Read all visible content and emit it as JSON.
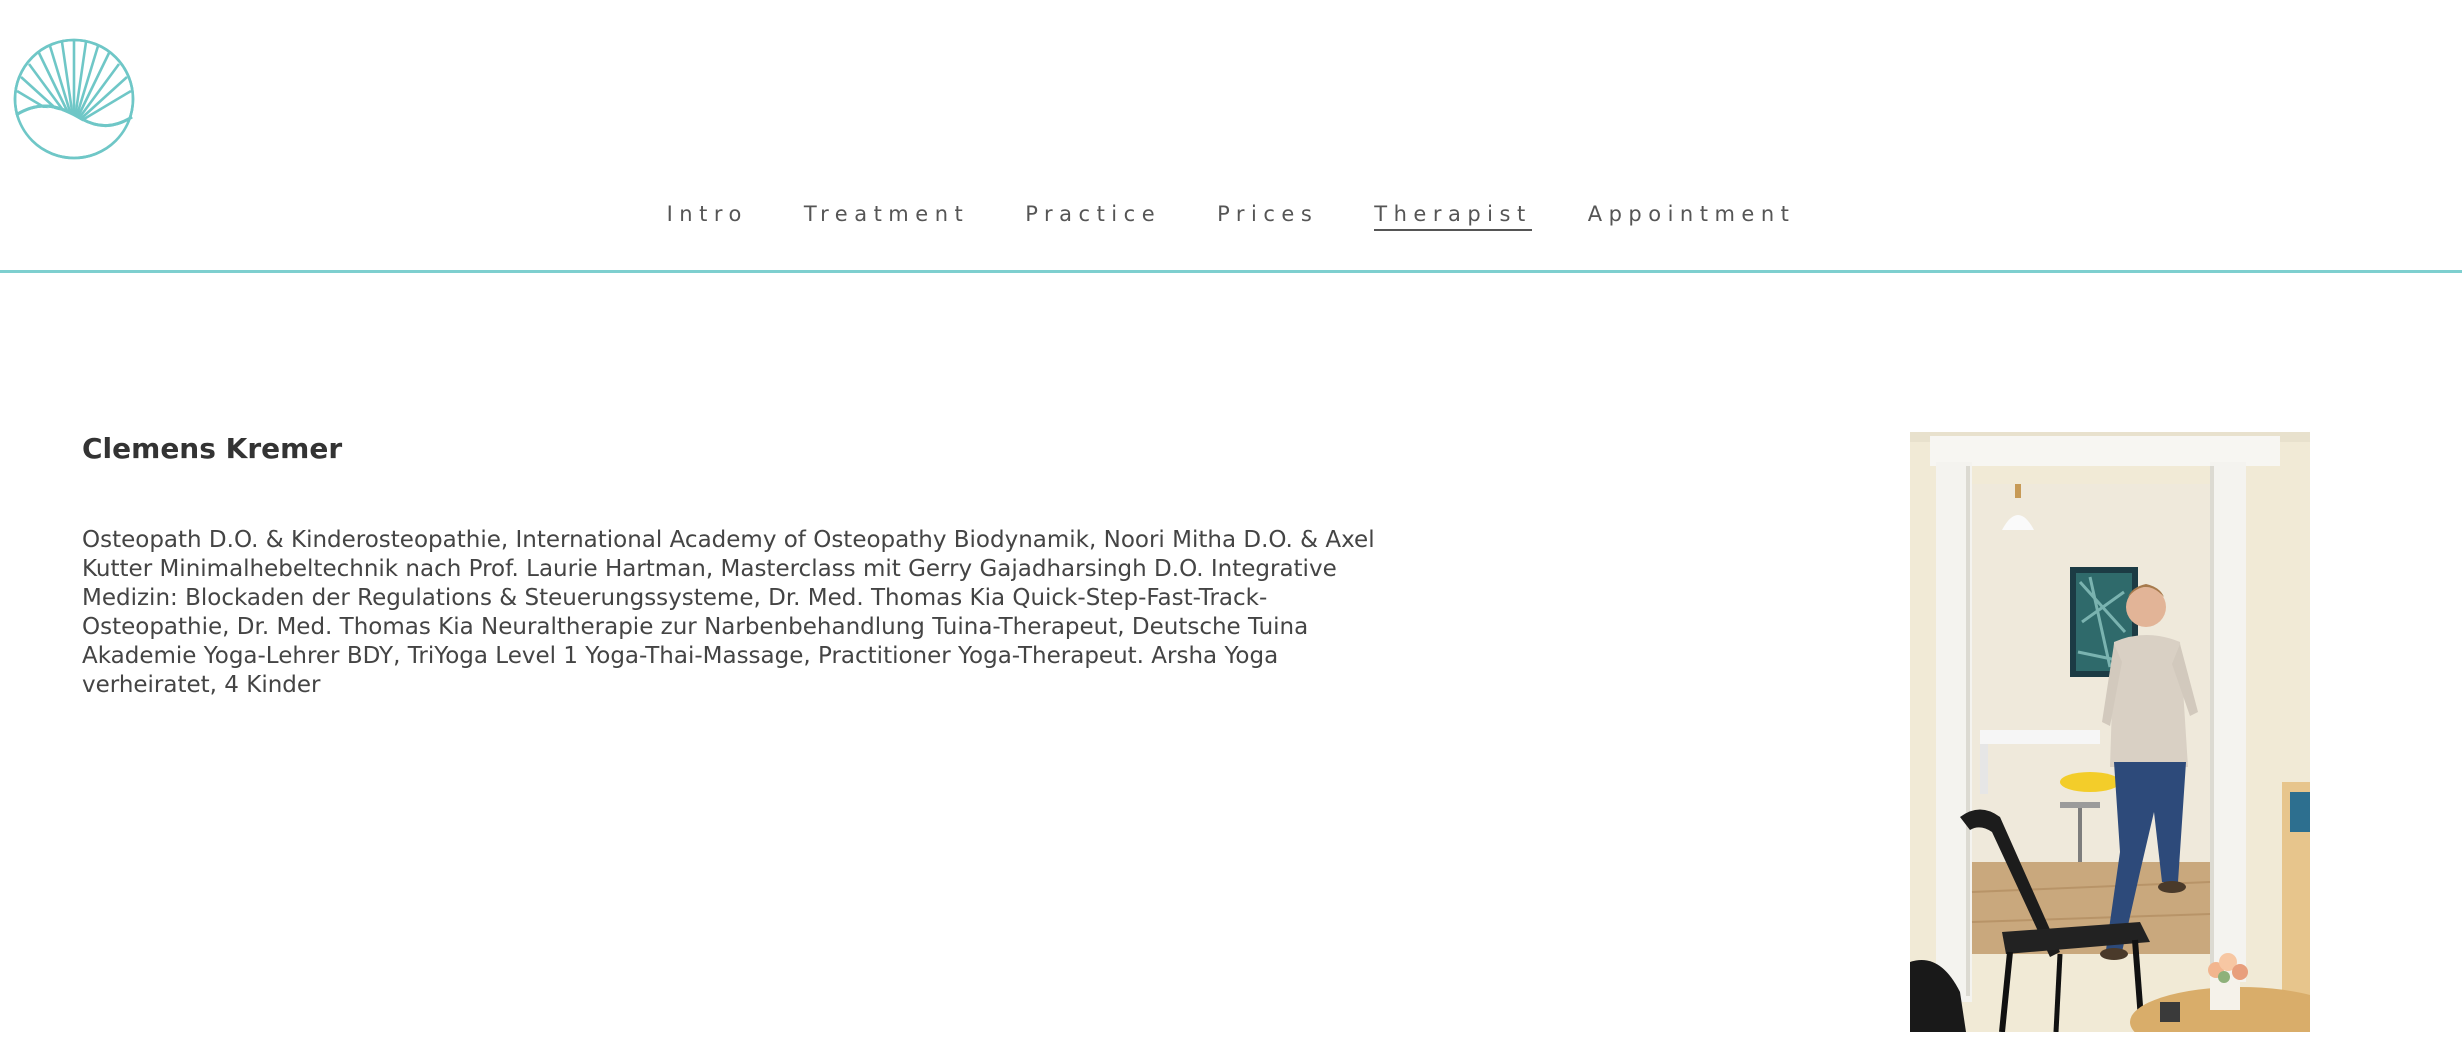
{
  "nav": {
    "items": [
      {
        "label": "Intro"
      },
      {
        "label": "Treatment"
      },
      {
        "label": "Practice"
      },
      {
        "label": "Prices"
      },
      {
        "label": "Therapist",
        "active": true
      },
      {
        "label": "Appointment"
      }
    ]
  },
  "therapist": {
    "name": "Clemens Kremer",
    "bio": "Osteopath D.O. & Kinderosteopathie, International Academy of Osteopathy Biodynamik, Noori Mitha D.O. & Axel Kutter Minimalhebeltechnik nach Prof. Laurie Hartman, Masterclass mit Gerry Gajadharsingh D.O. Integrative Medizin: Blockaden der Regulations & Steuerungssysteme, Dr. Med. Thomas Kia Quick-Step-Fast-Track-Osteopathie, Dr. Med. Thomas Kia Neuraltherapie zur Narbenbehandlung Tuina-Therapeut, Deutsche Tuina Akademie Yoga-Lehrer BDY, TriYoga Level 1 Yoga-Thai-Massage, Practitioner Yoga-Therapeut. Arsha Yoga verheiratet, 4 Kinder"
  },
  "colors": {
    "accent": "#7ecfcf",
    "nav_text": "#555555",
    "heading": "#333333",
    "body_text": "#444444",
    "background": "#ffffff"
  },
  "icons": {
    "logo": "sunrise-shell-logo-icon"
  }
}
